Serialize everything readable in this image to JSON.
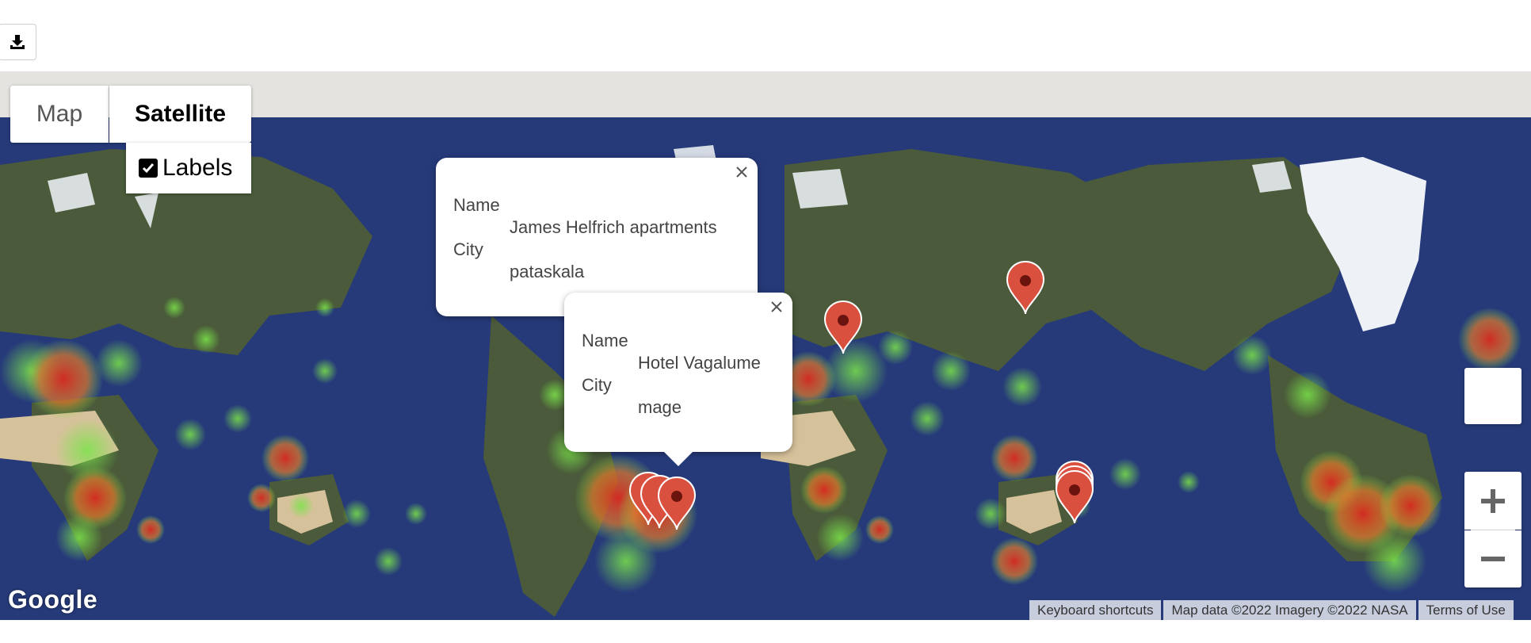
{
  "toolbar": {
    "download_icon": "download-icon"
  },
  "map": {
    "type_controls": {
      "map_label": "Map",
      "satellite_label": "Satellite",
      "selected": "Satellite"
    },
    "labels_toggle": {
      "label": "Labels",
      "checked": true
    },
    "info_windows": [
      {
        "name_key": "Name",
        "name_value": "James Helfrich apartments",
        "city_key": "City",
        "city_value": "pataskala"
      },
      {
        "name_key": "Name",
        "name_value": "Hotel Vagalume",
        "city_key": "City",
        "city_value": "mage"
      }
    ],
    "zoom": {
      "in_icon": "plus-icon",
      "out_icon": "minus-icon"
    },
    "logo": "Google",
    "attribution": {
      "shortcuts": "Keyboard shortcuts",
      "map_data": "Map data ©2022 Imagery ©2022 NASA",
      "terms": "Terms of Use"
    },
    "layer": "heatmap",
    "colors": {
      "marker": "#d9503f",
      "heat_low": "#7be34a",
      "heat_high": "#d92a1f",
      "ocean": "#263a7a"
    }
  }
}
